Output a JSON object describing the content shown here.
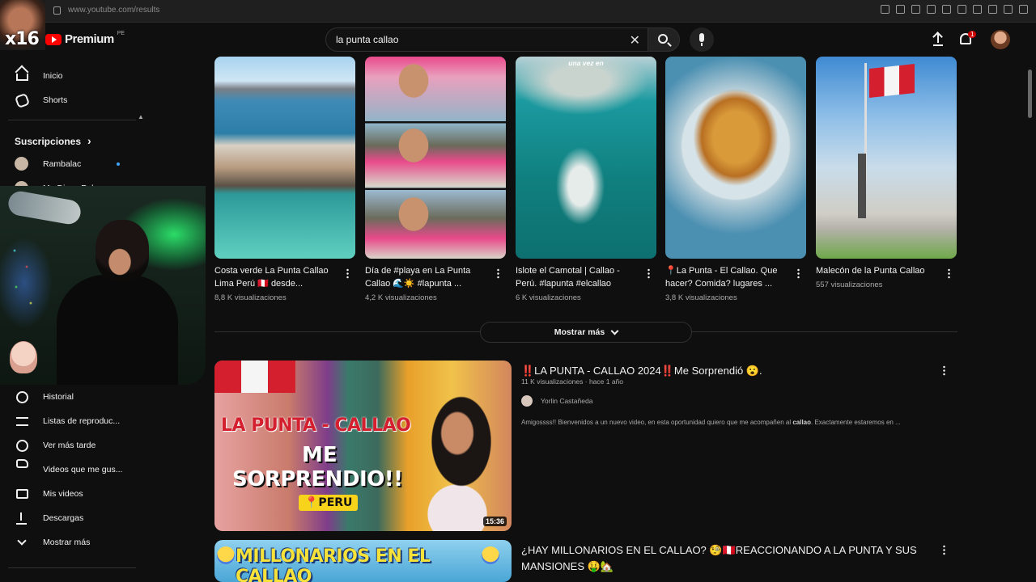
{
  "browser": {
    "url": "www.youtube.com/results"
  },
  "overlay": {
    "channel_tag": "x16"
  },
  "header": {
    "logo_text": "Premium",
    "country_code": "PE",
    "search_value": "la punta callao",
    "notifications_count": "1",
    "icons": [
      "search-icon",
      "mic-icon",
      "upload-icon",
      "bell-icon",
      "clear-icon"
    ]
  },
  "sidebar": {
    "items_top": [
      {
        "label": "Inicio",
        "icon": "home-icon"
      },
      {
        "label": "Shorts",
        "icon": "shorts-icon"
      }
    ],
    "subscriptions_heading": "Suscripciones",
    "subscriptions": [
      {
        "label": "Rambalac"
      },
      {
        "label": "Me Dicen Pol"
      }
    ],
    "items_bottom": [
      {
        "label": "Historial",
        "icon": "history-icon"
      },
      {
        "label": "Listas de reproduc...",
        "icon": "playlist-icon"
      },
      {
        "label": "Ver más tarde",
        "icon": "clock-icon"
      },
      {
        "label": "Videos que me gus...",
        "icon": "thumb-up-icon"
      },
      {
        "label": "Mis videos",
        "icon": "video-icon"
      },
      {
        "label": "Descargas",
        "icon": "download-icon"
      },
      {
        "label": "Mostrar más",
        "icon": "chevron-down-icon"
      }
    ]
  },
  "shorts": [
    {
      "title": "Costa verde La Punta Callao Lima Perú 🇵🇪 desde...",
      "views": "8,8 K visualizaciones"
    },
    {
      "title": "Día de #playa en La Punta Callao 🌊☀️ #lapunta ...",
      "views": "4,2 K visualizaciones"
    },
    {
      "title": "Islote el Camotal | Callao - Perú. #lapunta #elcallao",
      "views": "6 K visualizaciones",
      "overlay": "una vez en"
    },
    {
      "title": "📍La Punta - El Callao. Que hacer? Comida? lugares ...",
      "views": "3,8 K visualizaciones"
    },
    {
      "title": "Malecón de la Punta Callao",
      "views": "557 visualizaciones"
    }
  ],
  "mostrar_mas": "Mostrar más",
  "videos": [
    {
      "title": "‼️LA PUNTA - CALLAO 2024‼️Me Sorprendió 😮.",
      "meta": "11 K visualizaciones · hace 1 año",
      "channel": "Yorlin Castañeda",
      "desc_pre": "Amigossss!! Bienvenidos a un nuevo video, en esta oportunidad quiero que me acompañen al ",
      "desc_bold": "callao",
      "desc_post": ". Exactamente estaremos en ...",
      "duration": "15:36",
      "thumb_text_1": "LA PUNTA - CALLAO",
      "thumb_text_2": "ME",
      "thumb_text_3": "SORPRENDIO!!",
      "thumb_pill": "📍PERU"
    },
    {
      "title": "¿HAY MILLONARIOS EN EL CALLAO? 🧐🇵🇪REACCIONANDO A LA PUNTA Y SUS MANSIONES 🤑🏡",
      "thumb_text": "MILLONARIOS EN EL CALLAO"
    }
  ]
}
